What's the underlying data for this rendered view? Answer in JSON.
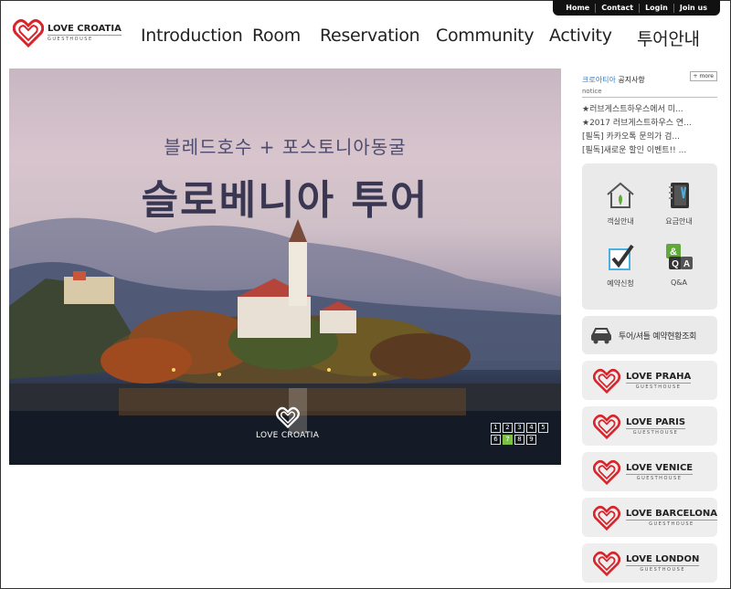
{
  "utility_nav": [
    "Home",
    "Contact",
    "Login",
    "Join us"
  ],
  "logo": {
    "name": "LOVE CROATIA",
    "sub": "GUESTHOUSE"
  },
  "main_nav": [
    "Introduction",
    "Room",
    "Reservation",
    "Community",
    "Activity",
    "투어안내"
  ],
  "hero": {
    "subtitle": "블레드호수 + 포스토니아동굴",
    "title": "슬로베니아 투어",
    "brand": "LOVE CROATIA",
    "pager": [
      "1",
      "2",
      "3",
      "4",
      "5",
      "6",
      "7",
      "8",
      "9"
    ],
    "active_page": "7"
  },
  "notice": {
    "title_blue": "크로아티아",
    "title_rest": " 공지사항",
    "subtitle": "notice",
    "more": "+ more",
    "items": [
      "★러브게스트하우스에서 미...",
      "★2017 러브게스트하우스 연...",
      "[필독] 카카오톡 문의가 검...",
      "[필독]새로운 할인 이벤트!! ..."
    ]
  },
  "quick_menu": [
    {
      "label": "객실안내",
      "icon": "house-icon"
    },
    {
      "label": "요금안내",
      "icon": "notebook-icon"
    },
    {
      "label": "예약신청",
      "icon": "checkbox-icon"
    },
    {
      "label": "Q&A",
      "icon": "qa-icon"
    }
  ],
  "tour_button": {
    "label": "투어/셔틀 예약현황조회",
    "icon": "car-icon"
  },
  "guesthouses": [
    {
      "name": "LOVE PRAHA",
      "sub": "GUESTHOUSE"
    },
    {
      "name": "LOVE PARIS",
      "sub": "GUESTHOUSE"
    },
    {
      "name": "LOVE VENICE",
      "sub": "GUESTHOUSE"
    },
    {
      "name": "LOVE BARCELONA",
      "sub": "GUESTHOUSE"
    },
    {
      "name": "LOVE LONDON",
      "sub": "GUESTHOUSE"
    }
  ],
  "colors": {
    "brand_red": "#d8242b",
    "util_bar": "#111111",
    "active_pager": "#7bc142"
  }
}
